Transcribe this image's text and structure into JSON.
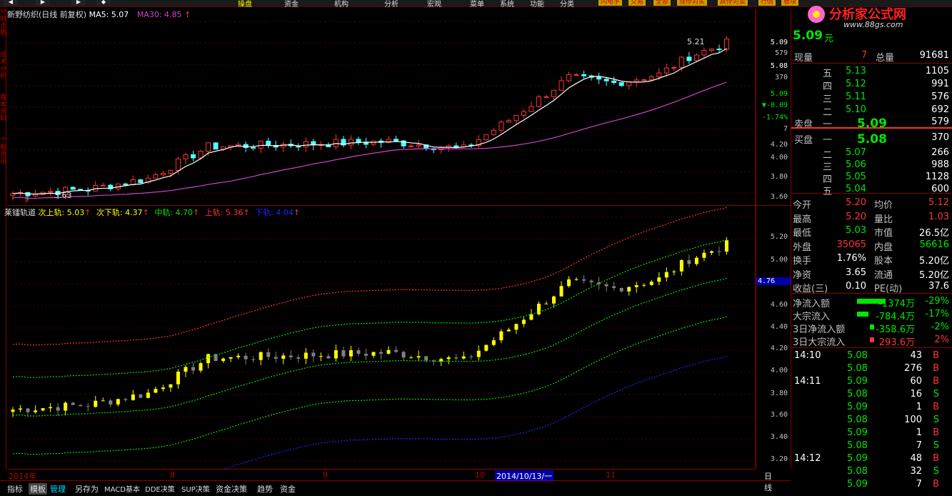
{
  "nav": {
    "items": [
      "操盘",
      "资金",
      "机构",
      "分析",
      "宏观",
      "菜单",
      "系统",
      "功能",
      "分类"
    ],
    "buttons": [
      "闪电手",
      "交易",
      "全部",
      "涨停对买",
      "跌停对卖",
      "行情",
      "板块"
    ]
  },
  "logo": {
    "title": "分析家公式网",
    "url": "www.88gs.com"
  },
  "left_tabs": [
    "分时走势",
    "技术分析",
    "基本资料",
    "个股资讯"
  ],
  "upper": {
    "legend": {
      "name": "新野纺织(日线 前复权)",
      "ma5": "MA5: 5.07",
      "ma30": "MA30: 4.85"
    },
    "annot_high": "5.21",
    "annot_low": "3.63",
    "marker": "$",
    "axis": [
      "5.09",
      "579",
      "5.08",
      "370",
      "5.09",
      "▼-0.09",
      "-1.74%",
      "7",
      "4.20",
      "4.00",
      "3.80",
      "3.60"
    ]
  },
  "lower": {
    "legend": {
      "name": "莱镭轨道",
      "l1": "次上轨: 5.03",
      "l2": "次下轨: 4.37",
      "l3": "中轨: 4.70",
      "l4": "上轨: 5.36",
      "l5": "下轨: 4.04"
    },
    "axis": [
      "5.20",
      "5.00",
      "4.80",
      "4.60",
      "4.40",
      "4.20",
      "4.00",
      "3.80",
      "3.60",
      "3.40",
      "3.20"
    ],
    "highlight": "4.76"
  },
  "xaxis": {
    "year": "2014年",
    "m8": "8",
    "m9": "9",
    "m10": "10",
    "cursor": "2014/10/13/一",
    "m11": "11",
    "period": "日线"
  },
  "bottom_tabs": [
    "指标",
    "模板",
    "管理",
    "另存为",
    "MACD基本",
    "DDE决策",
    "SUP决策",
    "资金决策",
    "趋势",
    "资金"
  ],
  "quote": {
    "price": "5.09",
    "unit": "元",
    "xianliang_label": "现量",
    "xianliang": "7",
    "zongliang_label": "总量",
    "zongliang": "91681",
    "asks": [
      {
        "l": "五",
        "p": "5.13",
        "v": "1105"
      },
      {
        "l": "四",
        "p": "5.12",
        "v": "991"
      },
      {
        "l": "三",
        "p": "5.11",
        "v": "576"
      },
      {
        "l": "二",
        "p": "5.10",
        "v": "692"
      }
    ],
    "ask1": {
      "label": "卖盘",
      "l": "一",
      "p": "5.09",
      "v": "579"
    },
    "bid1": {
      "label": "买盘",
      "l": "一",
      "p": "5.08",
      "v": "370"
    },
    "bids": [
      {
        "l": "二",
        "p": "5.07",
        "v": "266"
      },
      {
        "l": "三",
        "p": "5.06",
        "v": "988"
      },
      {
        "l": "四",
        "p": "5.05",
        "v": "1128"
      },
      {
        "l": "五",
        "p": "5.04",
        "v": "600"
      }
    ],
    "stats": [
      {
        "a": "今开",
        "av": "5.20",
        "b": "均价",
        "bv": "5.12"
      },
      {
        "a": "最高",
        "av": "5.20",
        "b": "量比",
        "bv": "1.03"
      },
      {
        "a": "最低",
        "av": "5.03",
        "b": "市值",
        "bv": "26.5亿"
      },
      {
        "a": "外盘",
        "av": "35065",
        "b": "内盘",
        "bv": "56616"
      },
      {
        "a": "换手",
        "av": "1.76%",
        "b": "股本",
        "bv": "5.20亿"
      },
      {
        "a": "净资",
        "av": "3.65",
        "b": "流通",
        "bv": "5.20亿"
      },
      {
        "a": "收益(三)",
        "av": "0.10",
        "b": "PE(动)",
        "bv": "37.6"
      }
    ],
    "flows": [
      {
        "n": "净流入额",
        "v": "-1374万",
        "p": "-29%"
      },
      {
        "n": "大宗流入",
        "v": "-784.4万",
        "p": "-17%"
      },
      {
        "n": "3日净流入额",
        "v": "-358.6万",
        "p": "-2%"
      },
      {
        "n": "3日大宗流入",
        "v": "293.6万",
        "p": "2%"
      }
    ],
    "ticks": [
      {
        "t": "14:10",
        "p": "5.08",
        "v": "43",
        "s": "B"
      },
      {
        "t": "",
        "p": "5.08",
        "v": "276",
        "s": "B"
      },
      {
        "t": "14:11",
        "p": "5.09",
        "v": "60",
        "s": "B"
      },
      {
        "t": "",
        "p": "5.08",
        "v": "16",
        "s": "S"
      },
      {
        "t": "",
        "p": "5.09",
        "v": "1",
        "s": "B"
      },
      {
        "t": "",
        "p": "5.08",
        "v": "100",
        "s": "S"
      },
      {
        "t": "",
        "p": "5.09",
        "v": "1",
        "s": "B"
      },
      {
        "t": "",
        "p": "5.08",
        "v": "7",
        "s": "S"
      },
      {
        "t": "14:12",
        "p": "5.09",
        "v": "48",
        "s": "B"
      },
      {
        "t": "",
        "p": "5.08",
        "v": "32",
        "s": "S"
      },
      {
        "t": "",
        "p": "5.09",
        "v": "7",
        "s": "B"
      }
    ]
  },
  "colors": {
    "up": "#ff3232",
    "down": "#54ffff",
    "ma5": "#ffffff",
    "ma30": "#cc44cc",
    "yellow": "#ffff00",
    "gray": "#808080",
    "green": "#00e600"
  }
}
